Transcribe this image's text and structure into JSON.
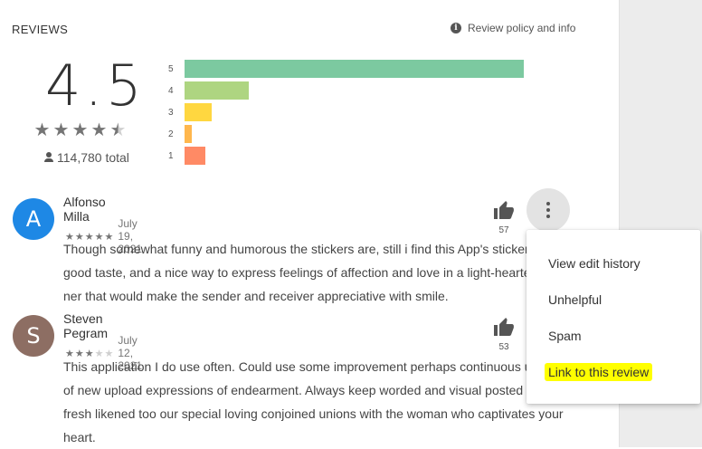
{
  "header": {
    "title": "REVIEWS",
    "policy_label": "Review policy and info",
    "policy_icon": "info-icon"
  },
  "summary": {
    "score": "4.5",
    "stars": 4.5,
    "total": "114,780 total",
    "histogram": [
      {
        "label": "5",
        "fraction": 1.0,
        "color": "#7cc9a0"
      },
      {
        "label": "4",
        "fraction": 0.19,
        "color": "#aed581"
      },
      {
        "label": "3",
        "fraction": 0.08,
        "color": "#ffd740"
      },
      {
        "label": "2",
        "fraction": 0.02,
        "color": "#ffb74d"
      },
      {
        "label": "1",
        "fraction": 0.06,
        "color": "#ff8a65"
      }
    ]
  },
  "reviews": [
    {
      "initial": "A",
      "avatar_color": "#1e88e5",
      "name": "Alfonso Milla",
      "rating": 5,
      "date": "July 19, 2021",
      "likes": "57",
      "lines": [
        "Though somewhat funny and humorous the stickers are, still i find this App's stickers",
        "good taste, and a nice way to express feelings of affection and love in a light-hearted",
        "ner that would make the sender and receiver appreciative with smile."
      ]
    },
    {
      "initial": "S",
      "avatar_color": "#8d6e63",
      "name": "Steven Pegram",
      "rating": 3,
      "date": "July 12, 2021",
      "likes": "53",
      "lines": [
        "This application I do use often. Could use some improvement perhaps continuous u",
        "of new upload expressions of endearment. Always keep worded and visual posted c",
        "fresh likened too our special loving conjoined unions with the woman who captivates your",
        "heart."
      ]
    }
  ],
  "menu": {
    "items": [
      "View edit history",
      "Unhelpful",
      "Spam",
      "Link to this review"
    ],
    "highlight_color": "#ffff00"
  }
}
